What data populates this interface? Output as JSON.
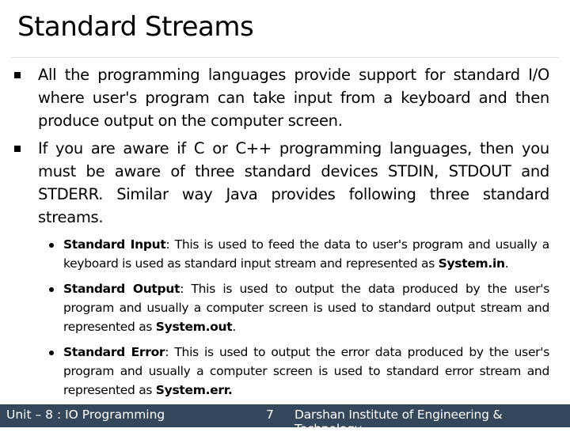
{
  "slide": {
    "title": "Standard Streams",
    "bullets": [
      {
        "text": "All the programming languages provide support for standard I/O where user's program can take input from a keyboard and then produce output on the computer screen."
      },
      {
        "text": "If you are aware if C or C++ programming languages, then you must be aware of three standard devices STDIN, STDOUT and STDERR. Similar way Java provides following three standard streams."
      }
    ],
    "sub_bullets": [
      {
        "term": "Standard Input",
        "text": ": This is used to feed the data to user's program and usually a keyboard is used as standard input stream and represented as ",
        "code": "System.in",
        "end": "."
      },
      {
        "term": "Standard Output",
        "text": ": This is used to output the data produced by the user's program and usually a computer screen is used to standard output stream and represented as ",
        "code": "System.out",
        "end": "."
      },
      {
        "term": "Standard Error",
        "text": ": This is used to output the error data produced by the user's program and usually a computer screen is used to standard error stream and represented as ",
        "code": "System.err.",
        "end": ""
      }
    ]
  },
  "footer": {
    "unit": "Unit – 8 : IO Programming",
    "page_number": "7",
    "institute": "Darshan Institute of Engineering & Technology",
    "background_color": "#35475a"
  }
}
